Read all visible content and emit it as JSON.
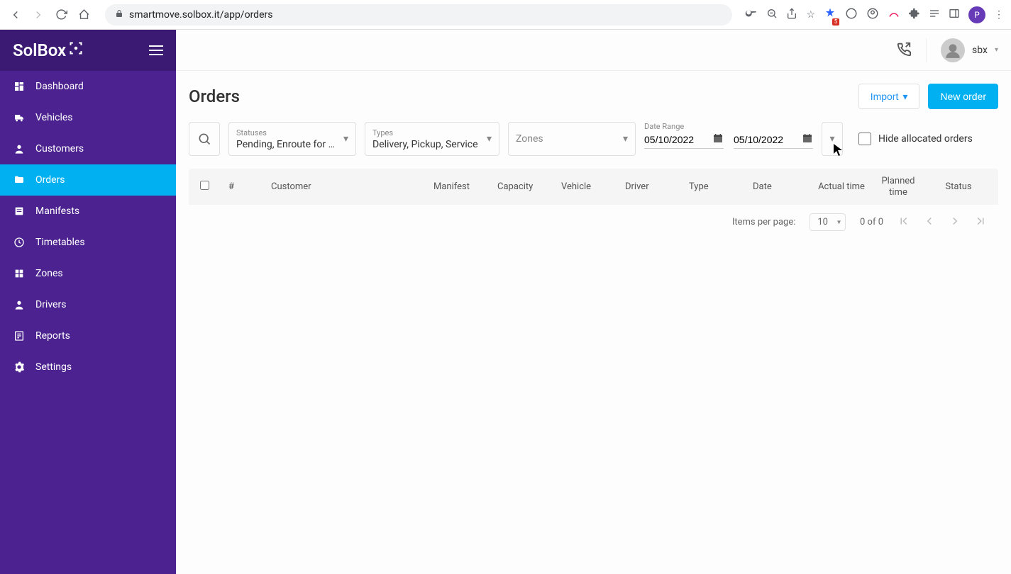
{
  "browser": {
    "url": "smartmove.solbox.it/app/orders",
    "ext_badge": "5",
    "profile_initial": "P"
  },
  "brand": "SolBox",
  "sidebar": {
    "items": [
      {
        "label": "Dashboard"
      },
      {
        "label": "Vehicles"
      },
      {
        "label": "Customers"
      },
      {
        "label": "Orders",
        "active": true
      },
      {
        "label": "Manifests"
      },
      {
        "label": "Timetables"
      },
      {
        "label": "Zones"
      },
      {
        "label": "Drivers"
      },
      {
        "label": "Reports"
      },
      {
        "label": "Settings"
      }
    ]
  },
  "topbar": {
    "user": "sbx"
  },
  "page": {
    "title": "Orders",
    "import_label": "Import",
    "new_order_label": "New order"
  },
  "filters": {
    "statuses_label": "Statuses",
    "statuses": "Pending, Enroute for del…",
    "types_label": "Types",
    "types": "Delivery, Pickup, Service",
    "zones_placeholder": "Zones",
    "date_range_label": "Date Range",
    "date_from": "05/10/2022",
    "date_to": "05/10/2022",
    "hide_allocated_label": "Hide allocated orders"
  },
  "table": {
    "cols": {
      "num": "#",
      "customer": "Customer",
      "manifest": "Manifest",
      "capacity": "Capacity",
      "vehicle": "Vehicle",
      "driver": "Driver",
      "type": "Type",
      "date": "Date",
      "actual_time": "Actual time",
      "planned_time": "Planned time",
      "status": "Status"
    }
  },
  "paginator": {
    "items_label": "Items per page:",
    "items_value": "10",
    "range": "0 of 0"
  }
}
